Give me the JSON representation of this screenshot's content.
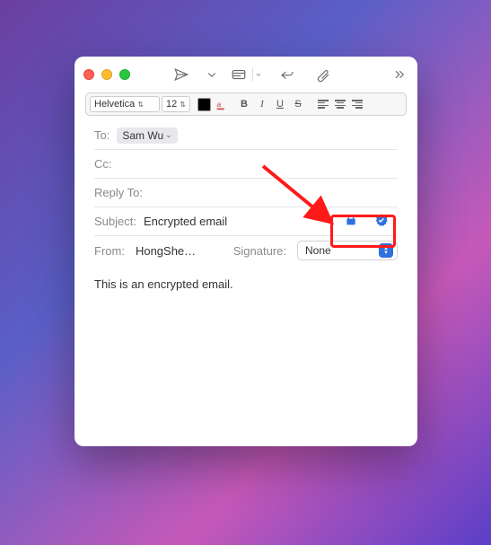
{
  "toolbar": {
    "send_icon": "send",
    "list_icon": "header-fields",
    "reply_icon": "reply",
    "attach_icon": "attach",
    "overflow_icon": "more"
  },
  "format_bar": {
    "font": "Helvetica",
    "size": "12",
    "bold": "B",
    "italic": "I",
    "underline": "U",
    "strike": "S"
  },
  "headers": {
    "to_label": "To:",
    "to_value": "Sam Wu",
    "cc_label": "Cc:",
    "reply_to_label": "Reply To:",
    "subject_label": "Subject:",
    "subject_value": "Encrypted email",
    "from_label": "From:",
    "from_value": "HongShe…",
    "signature_label": "Signature:",
    "signature_value": "None"
  },
  "body_text": "This is an encrypted email.",
  "annotation": {
    "highlights": "encryption-and-signing-icons"
  }
}
